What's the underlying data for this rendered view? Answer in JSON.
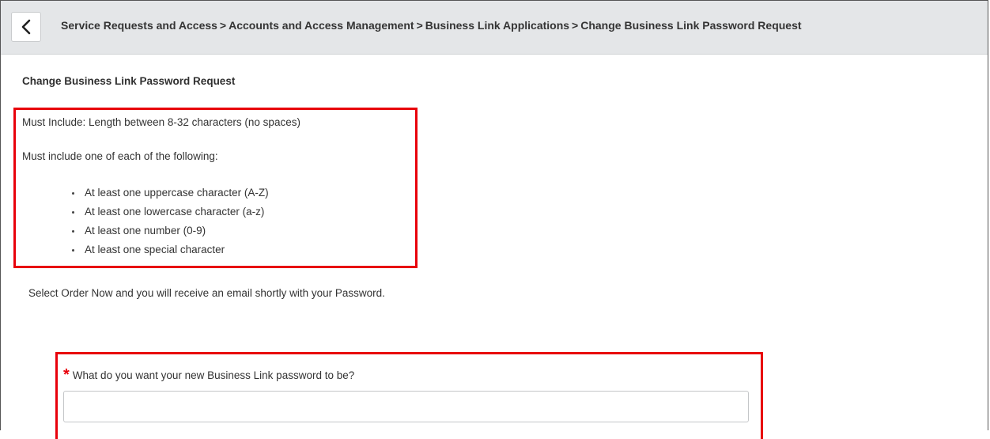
{
  "header": {
    "back_icon": "chevron-left-icon",
    "breadcrumb": [
      "Service Requests and Access",
      "Accounts and Access Management",
      "Business Link Applications",
      "Change Business Link Password Request"
    ],
    "separator": ">"
  },
  "form": {
    "title": "Change Business Link Password Request",
    "rules": {
      "length_rule": "Must Include: Length between 8-32 characters (no spaces)",
      "intro": "Must include one of each of the following:",
      "items": [
        "At least one uppercase character (A-Z)",
        "At least one lowercase character (a-z)",
        "At least one number (0-9)",
        "At least one special character"
      ]
    },
    "instruction": "Select Order Now and you will receive an email shortly with your Password.",
    "password_field": {
      "required_marker": "*",
      "label": "What do you want your new Business Link password to be?",
      "value": ""
    }
  },
  "colors": {
    "highlight": "#e8000b",
    "header_bg": "#e4e6e8"
  }
}
